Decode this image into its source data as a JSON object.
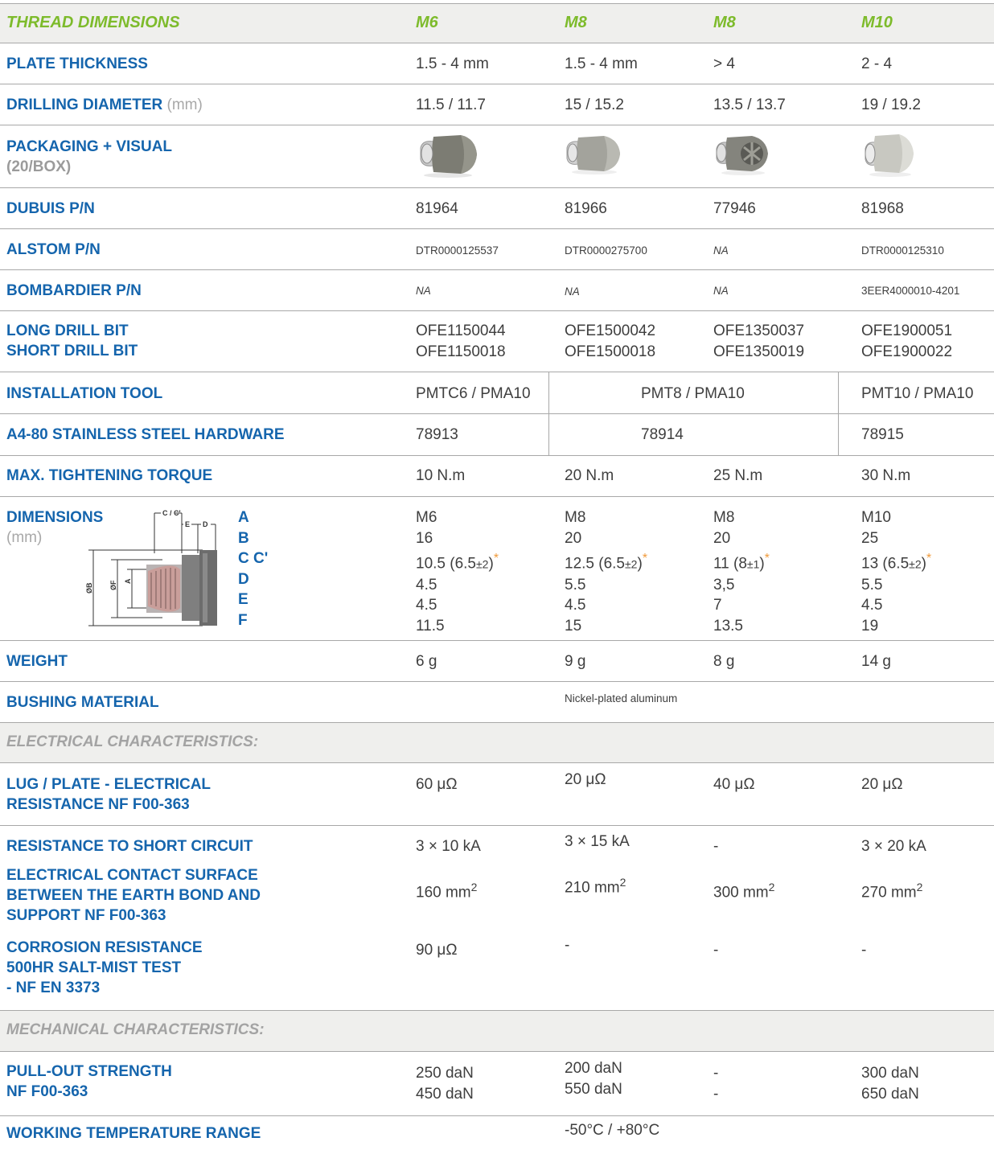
{
  "header": {
    "label": "THREAD DIMENSIONS",
    "columns": [
      "M6",
      "M8",
      "M8",
      "M10"
    ]
  },
  "rows": {
    "plate_thickness": {
      "label": "PLATE THICKNESS",
      "values": [
        "1.5 - 4 mm",
        "1.5 - 4 mm",
        "> 4",
        "2 - 4"
      ]
    },
    "drilling_diameter": {
      "label": "DRILLING DIAMETER",
      "unit": "(mm)",
      "values": [
        "11.5 / 11.7",
        "15 / 15.2",
        "13.5 / 13.7",
        "19 / 19.2"
      ]
    },
    "packaging": {
      "label": "PACKAGING + VISUAL",
      "sub": "(20/BOX)"
    },
    "dubuis_pn": {
      "label": "DUBUIS P/N",
      "values": [
        "81964",
        "81966",
        "77946",
        "81968"
      ]
    },
    "alstom_pn": {
      "label": "ALSTOM P/N",
      "values": [
        "DTR0000125537",
        "DTR0000275700",
        "NA",
        "DTR0000125310"
      ]
    },
    "bombardier_pn": {
      "label": "BOMBARDIER P/N",
      "values": [
        "NA",
        "NA",
        "NA",
        "3EER4000010-4201"
      ]
    },
    "drill_bits": {
      "label_long": "LONG DRILL BIT",
      "label_short": "SHORT DRILL BIT",
      "long": [
        "OFE1150044",
        "OFE1500042",
        "OFE1350037",
        "OFE1900051"
      ],
      "short": [
        "OFE1150018",
        "OFE1500018",
        "OFE1350019",
        "OFE1900022"
      ]
    },
    "installation_tool": {
      "label": "INSTALLATION TOOL",
      "values": [
        "PMTC6 / PMA10",
        "PMT8 / PMA10",
        "PMT10 / PMA10"
      ]
    },
    "hardware": {
      "label": "A4-80 STAINLESS STEEL HARDWARE",
      "values": [
        "78913",
        "78914",
        "78915"
      ]
    },
    "torque": {
      "label": "MAX. TIGHTENING TORQUE",
      "values": [
        "10 N.m",
        "20 N.m",
        "25 N.m",
        "30 N.m"
      ]
    },
    "dimensions": {
      "label": "DIMENSIONS",
      "unit": "(mm)",
      "letters": [
        "A",
        "B",
        "C C'",
        "D",
        "E",
        "F"
      ],
      "diagram_labels": {
        "c": "C / C'",
        "e": "E",
        "d": "D",
        "b": "ØB",
        "f": "ØF",
        "a": "A"
      },
      "columns": [
        {
          "A": "M6",
          "B": "16",
          "C": "10.5 (6.5",
          "C_tol": "±2",
          "D": "4.5",
          "E": "4.5",
          "F": "11.5"
        },
        {
          "A": "M8",
          "B": "20",
          "C": "12.5 (6.5",
          "C_tol": "±2",
          "D": "5.5",
          "E": "4.5",
          "F": "15"
        },
        {
          "A": "M8",
          "B": "20",
          "C": "11 (8",
          "C_tol": "±1",
          "D": "3,5",
          "E": "7",
          "F": "13.5"
        },
        {
          "A": "M10",
          "B": "25",
          "C": "13 (6.5",
          "C_tol": "±2",
          "D": "5.5",
          "E": "4.5",
          "F": "19"
        }
      ],
      "star": "*",
      "close_paren": ")"
    },
    "weight": {
      "label": "WEIGHT",
      "values": [
        "6 g",
        "9 g",
        "8 g",
        "14 g"
      ]
    },
    "bushing_material": {
      "label": "BUSHING MATERIAL",
      "value": "Nickel-plated aluminum"
    },
    "electrical_section": "ELECTRICAL CHARACTERISTICS:",
    "lug_resistance": {
      "label_1": "LUG / PLATE - ELECTRICAL",
      "label_2": "RESISTANCE NF F00-363",
      "values": [
        "60 μΩ",
        "20 μΩ",
        "40 μΩ",
        "20 μΩ"
      ]
    },
    "short_circuit": {
      "label": "RESISTANCE TO SHORT CIRCUIT",
      "values": [
        "3 × 10 kA",
        "3 × 15 kA",
        "-",
        "3 × 20 kA"
      ]
    },
    "contact_surface": {
      "label_1": "ELECTRICAL CONTACT SURFACE",
      "label_2": "BETWEEN THE EARTH BOND AND",
      "label_3": "SUPPORT NF F00-363",
      "values": [
        "160 mm",
        "210 mm",
        "300 mm",
        "270 mm"
      ],
      "sup": "2"
    },
    "corrosion": {
      "label_1": "CORROSION RESISTANCE",
      "label_2": "500HR SALT-MIST TEST",
      "label_3": "- NF EN 3373",
      "values": [
        "90 μΩ",
        "-",
        "-",
        "-"
      ]
    },
    "mechanical_section": "MECHANICAL CHARACTERISTICS:",
    "pull_out": {
      "label_1": "PULL-OUT STRENGTH",
      "label_2": "NF F00-363",
      "line1": [
        "250 daN",
        "200 daN",
        "-",
        "300 daN"
      ],
      "line2": [
        "450 daN",
        "550 daN",
        "-",
        "650 daN"
      ]
    },
    "temperature": {
      "label": "WORKING TEMPERATURE RANGE",
      "value": "-50°C / +80°C"
    }
  },
  "colors": {
    "label_blue": "#1565ad",
    "header_green": "#7dbb2b",
    "section_grey": "#a3a3a3",
    "shade": "#efefed",
    "star_orange": "#f09a3a"
  }
}
